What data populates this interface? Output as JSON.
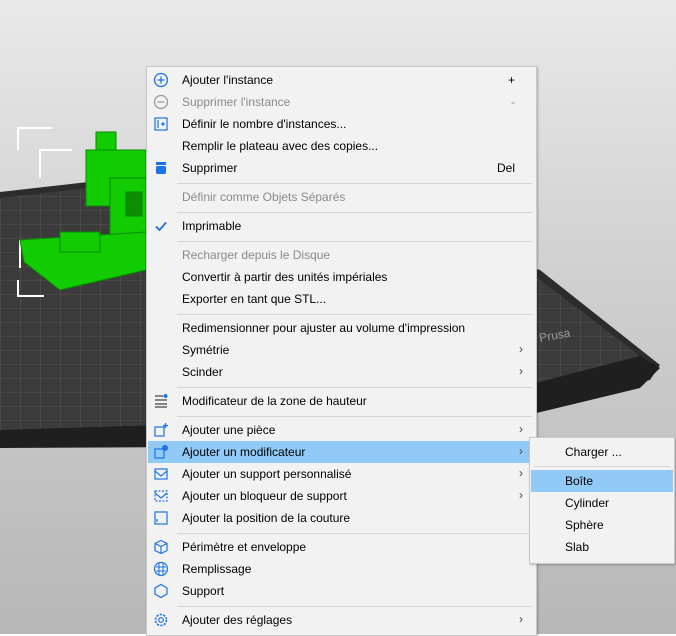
{
  "menu": {
    "add_instance": {
      "label": "Ajouter l'instance",
      "shortcut": "+"
    },
    "remove_instance": {
      "label": "Supprimer l'instance",
      "shortcut": "-"
    },
    "set_instances": {
      "label": "Définir le nombre d'instances..."
    },
    "fill_bed": {
      "label": "Remplir le plateau avec des copies..."
    },
    "delete": {
      "label": "Supprimer",
      "shortcut": "Del"
    },
    "set_separate": {
      "label": "Définir comme Objets Séparés"
    },
    "printable": {
      "label": "Imprimable",
      "checked": true
    },
    "reload": {
      "label": "Recharger depuis le Disque"
    },
    "convert_imperial": {
      "label": "Convertir à partir des unités impériales"
    },
    "export_stl": {
      "label": "Exporter en tant que STL..."
    },
    "scale_to_volume": {
      "label": "Redimensionner pour ajuster au volume d'impression"
    },
    "mirror": {
      "label": "Symétrie"
    },
    "split": {
      "label": "Scinder"
    },
    "height_modifier": {
      "label": "Modificateur de la zone de hauteur"
    },
    "add_part": {
      "label": "Ajouter une pièce"
    },
    "add_modifier": {
      "label": "Ajouter un modificateur"
    },
    "add_support_enforcer": {
      "label": "Ajouter un support personnalisé"
    },
    "add_support_blocker": {
      "label": "Ajouter un bloqueur de support"
    },
    "add_seam": {
      "label": "Ajouter la position de la couture"
    },
    "perimeters": {
      "label": "Périmètre et enveloppe"
    },
    "infill": {
      "label": "Remplissage"
    },
    "support": {
      "label": "Support"
    },
    "add_settings": {
      "label": "Ajouter des réglages"
    }
  },
  "submenu": {
    "load": "Charger ...",
    "box": "Boîte",
    "cylinder": "Cylinder",
    "sphere": "Sphère",
    "slab": "Slab"
  },
  "bed_brand": "Prusa",
  "colors": {
    "accent": "#1a73e8",
    "highlight": "#91c9f7",
    "model_green": "#11cc00",
    "bed": "#333333"
  }
}
